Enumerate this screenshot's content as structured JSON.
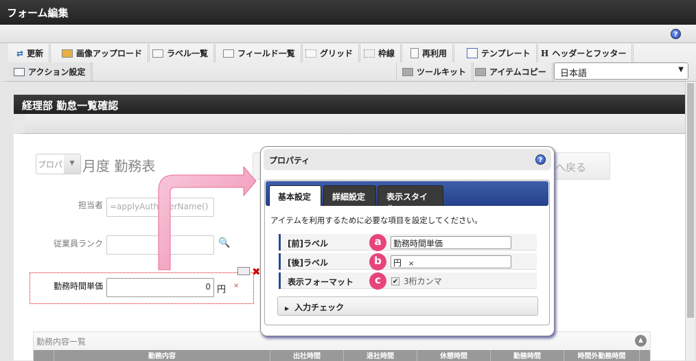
{
  "window": {
    "title": "フォーム編集",
    "help_icon": "help-icon"
  },
  "toolbar": {
    "row1": [
      {
        "label": "更新",
        "icon": "update-icon"
      },
      {
        "label": "画像アップロード",
        "icon": "image-upload-icon"
      },
      {
        "label": "ラベル一覧",
        "icon": "list-icon"
      },
      {
        "label": "フィールド一覧",
        "icon": "list-icon"
      },
      {
        "label": "グリッド",
        "icon": "grid-icon"
      },
      {
        "label": "枠線",
        "icon": "border-icon"
      },
      {
        "label": "再利用",
        "icon": "copy-icon"
      },
      {
        "label": "テンプレート",
        "icon": "template-icon"
      },
      {
        "label": "ヘッダーとフッター",
        "icon": "h-icon"
      }
    ],
    "row2": [
      {
        "label": "アクション設定",
        "icon": "action-icon"
      },
      {
        "label": "ツールキット",
        "icon": "toolbox-icon"
      },
      {
        "label": "アイテムコピー",
        "icon": "toolbox-icon"
      }
    ],
    "language": "日本語"
  },
  "panel": {
    "title": "経理部 勤怠一覧確認"
  },
  "form": {
    "select_value": "プロパ",
    "heading": "月度 勤務表",
    "back_button": "へ戻る",
    "fields": [
      {
        "label": "担当者",
        "value": "=applyAuthUserName()"
      },
      {
        "label": "従業員ランク",
        "value": ""
      },
      {
        "label": "勤務時間単価",
        "value": "0",
        "suffix": "円",
        "remove": "×"
      }
    ],
    "section": {
      "title": "勤務内容一覧",
      "columns": [
        "勤務内容",
        "出社時間",
        "退社時間",
        "休憩時間",
        "勤務時間",
        "時間外勤務時間"
      ]
    }
  },
  "dialog": {
    "title": "プロパティ",
    "tabs": [
      "基本設定",
      "詳細設定",
      "表示スタイル"
    ],
    "active_tab": "基本設定",
    "description": "アイテムを利用するために必要な項目を設定してください。",
    "rows": [
      {
        "label": "[前]ラベル",
        "badge": "a",
        "value": "勤務時間単価"
      },
      {
        "label": "[後]ラベル",
        "badge": "b",
        "value": "円",
        "remove": "×"
      },
      {
        "label": "表示フォーマット",
        "badge": "c",
        "checkbox_label": "3桁カンマ",
        "checked": true
      }
    ],
    "accordion": "入力チェック",
    "colors": {
      "tab_bar": "#2c4a8e",
      "badge": "#e8447c",
      "arrow": "#f4a0c0"
    }
  }
}
